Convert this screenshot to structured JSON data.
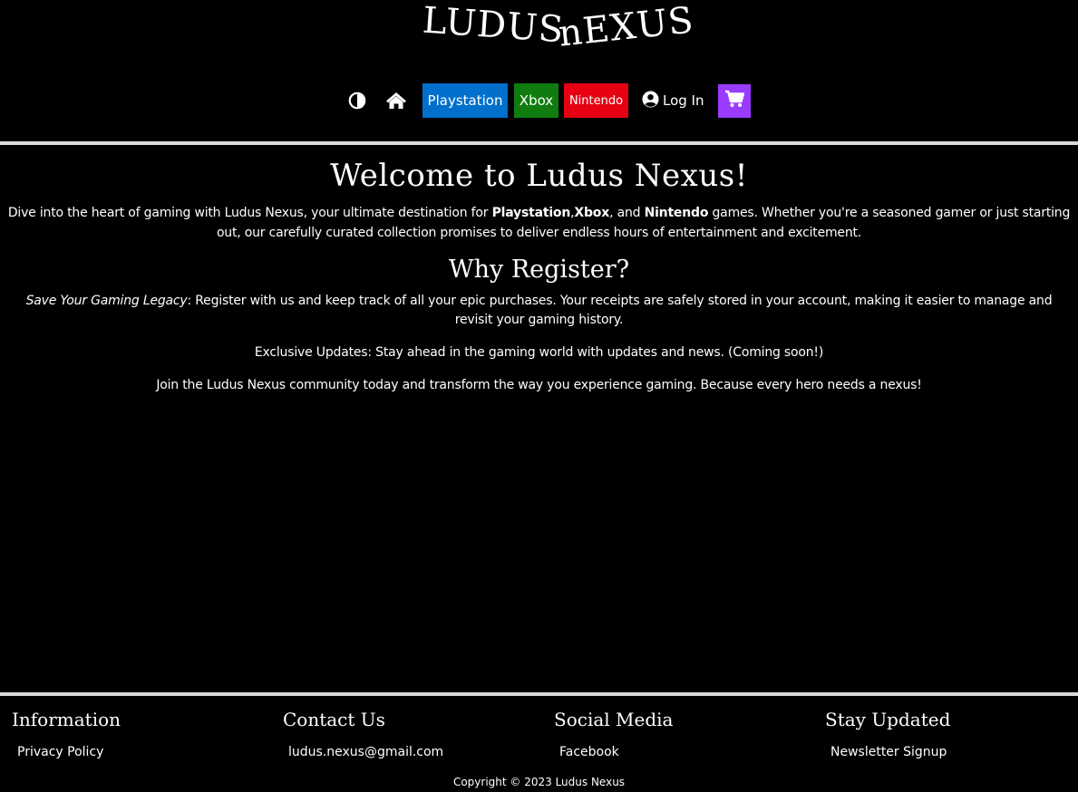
{
  "header": {
    "logo_word_1": "LUDUS",
    "logo_word_2": "nEXUS"
  },
  "nav": {
    "contrast_icon": "contrast-icon",
    "home_icon": "home-icon",
    "playstation_label": "Playstation",
    "xbox_label": "Xbox",
    "nintendo_label": "Nintendo",
    "login_icon": "user-circle-icon",
    "login_label": "Log In",
    "cart_icon": "cart-icon"
  },
  "colors": {
    "background": "#000000",
    "text": "#ffffff",
    "playstation": "#0070cc",
    "xbox": "#107c10",
    "nintendo": "#e60012",
    "cart": "#9b3bff",
    "rule": "#d9d9d9"
  },
  "main": {
    "welcome_title": "Welcome to Ludus Nexus!",
    "intro_before": "Dive into the heart of gaming with Ludus Nexus, your ultimate destination for ",
    "intro_ps": "Playstation",
    "intro_comma": ",",
    "intro_xbox": "Xbox",
    "intro_and": ", and ",
    "intro_nintendo": "Nintendo",
    "intro_after": " games. Whether you're a seasoned gamer or just starting out, our carefully curated collection promises to deliver endless hours of entertainment and excitement.",
    "why_title": "Why Register?",
    "legacy_label": "Save Your Gaming Legacy",
    "legacy_text": ": Register with us and keep track of all your epic purchases. Your receipts are safely stored in your account, making it easier to manage and revisit your gaming history.",
    "updates_text": "Exclusive Updates: Stay ahead in the gaming world with updates and news. (Coming soon!)",
    "join_text": "Join the Ludus Nexus community today and transform the way you experience gaming. Because every hero needs a nexus!"
  },
  "footer": {
    "columns": [
      {
        "heading": "Information",
        "link": "Privacy Policy"
      },
      {
        "heading": "Contact Us",
        "link": "ludus.nexus@gmail.com"
      },
      {
        "heading": "Social Media",
        "link": "Facebook"
      },
      {
        "heading": "Stay Updated",
        "link": "Newsletter Signup"
      }
    ],
    "copyright": "Copyright © 2023 Ludus Nexus"
  }
}
